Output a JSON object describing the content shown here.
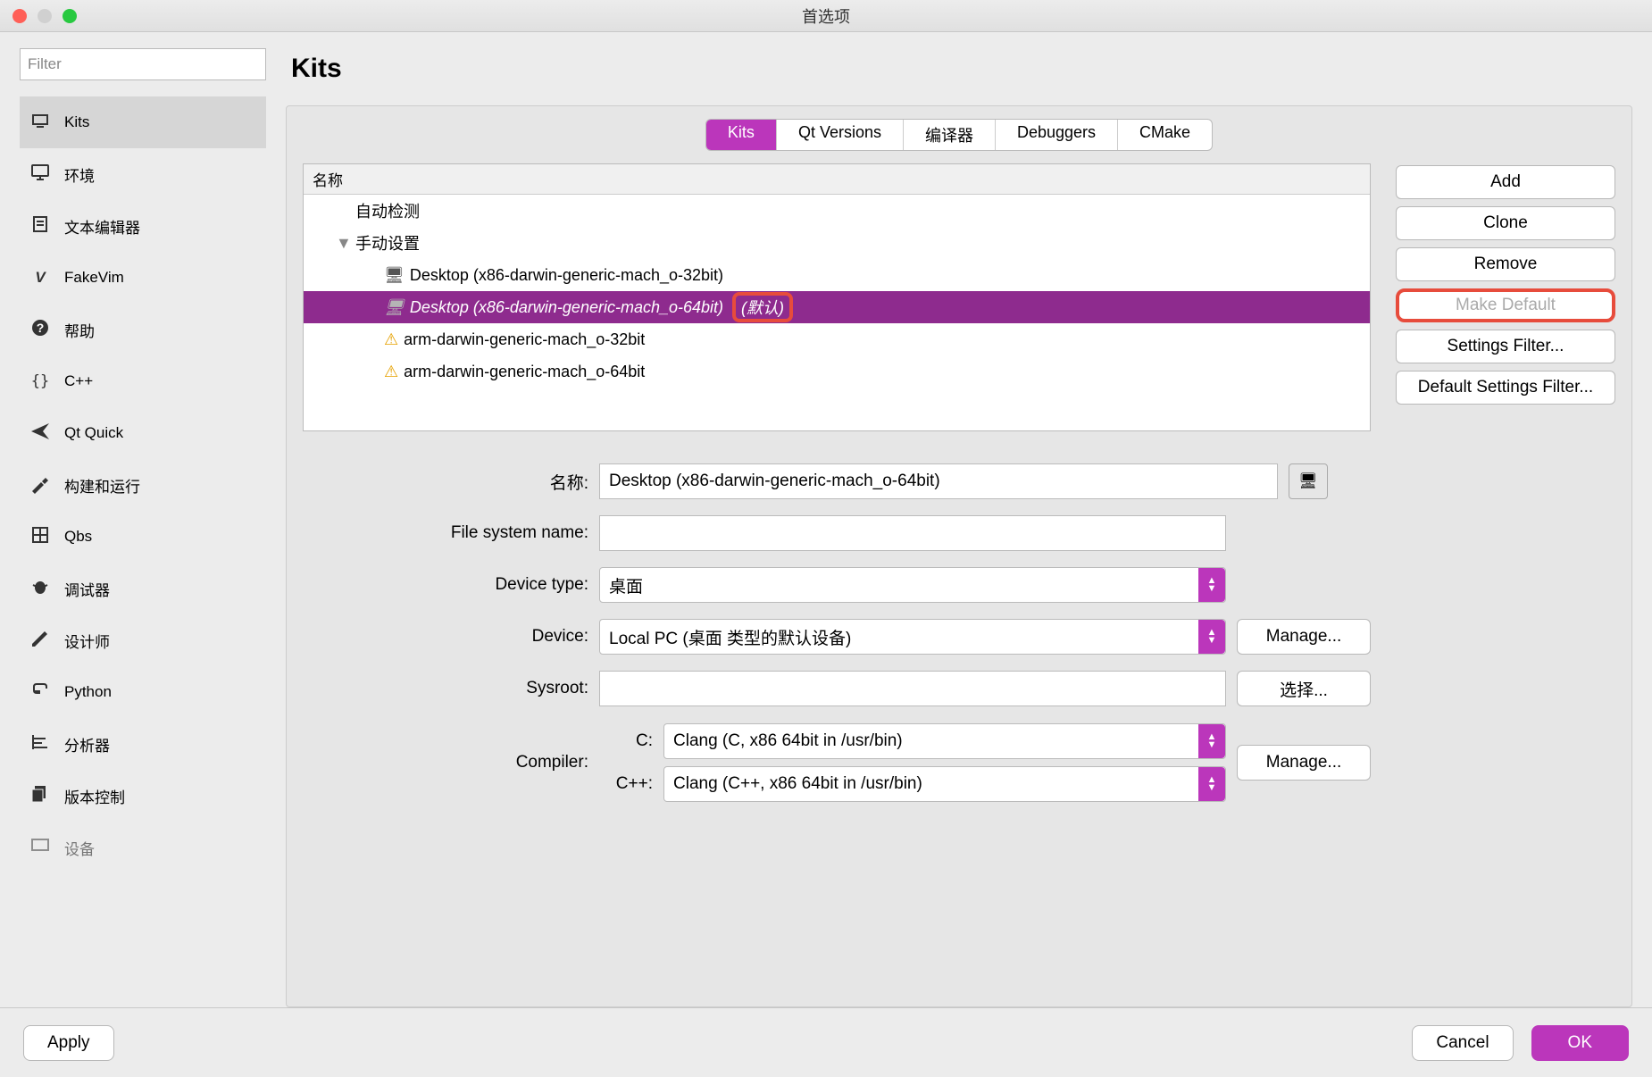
{
  "window": {
    "title": "首选项"
  },
  "filter": {
    "placeholder": "Filter"
  },
  "sidebar": {
    "items": [
      {
        "label": "Kits"
      },
      {
        "label": "环境"
      },
      {
        "label": "文本编辑器"
      },
      {
        "label": "FakeVim"
      },
      {
        "label": "帮助"
      },
      {
        "label": "C++"
      },
      {
        "label": "Qt Quick"
      },
      {
        "label": "构建和运行"
      },
      {
        "label": "Qbs"
      },
      {
        "label": "调试器"
      },
      {
        "label": "设计师"
      },
      {
        "label": "Python"
      },
      {
        "label": "分析器"
      },
      {
        "label": "版本控制"
      },
      {
        "label": "设备"
      }
    ]
  },
  "page_title": "Kits",
  "tabs": [
    "Kits",
    "Qt Versions",
    "编译器",
    "Debuggers",
    "CMake"
  ],
  "tree": {
    "header": "名称",
    "auto_detect": "自动检测",
    "manual": "手动设置",
    "rows": [
      {
        "label": "Desktop (x86-darwin-generic-mach_o-32bit)",
        "icon": "monitor"
      },
      {
        "label": "Desktop (x86-darwin-generic-mach_o-64bit)",
        "icon": "monitor",
        "default_suffix": "(默认)",
        "selected": true
      },
      {
        "label": "arm-darwin-generic-mach_o-32bit",
        "icon": "warn"
      },
      {
        "label": "arm-darwin-generic-mach_o-64bit",
        "icon": "warn"
      }
    ]
  },
  "actions": {
    "add": "Add",
    "clone": "Clone",
    "remove": "Remove",
    "make_default": "Make Default",
    "settings_filter": "Settings Filter...",
    "default_settings_filter": "Default Settings Filter..."
  },
  "form": {
    "name_label": "名称:",
    "name_value": "Desktop (x86-darwin-generic-mach_o-64bit)",
    "fs_label": "File system name:",
    "fs_value": "",
    "device_type_label": "Device type:",
    "device_type_value": "桌面",
    "device_label": "Device:",
    "device_value": "Local PC (桌面 类型的默认设备)",
    "manage": "Manage...",
    "sysroot_label": "Sysroot:",
    "sysroot_value": "",
    "choose": "选择...",
    "compiler_label": "Compiler:",
    "c_label": "C:",
    "c_value": "Clang (C, x86 64bit in /usr/bin)",
    "cpp_label": "C++:",
    "cpp_value": "Clang (C++, x86 64bit in /usr/bin)",
    "manage2": "Manage..."
  },
  "footer": {
    "apply": "Apply",
    "cancel": "Cancel",
    "ok": "OK"
  }
}
